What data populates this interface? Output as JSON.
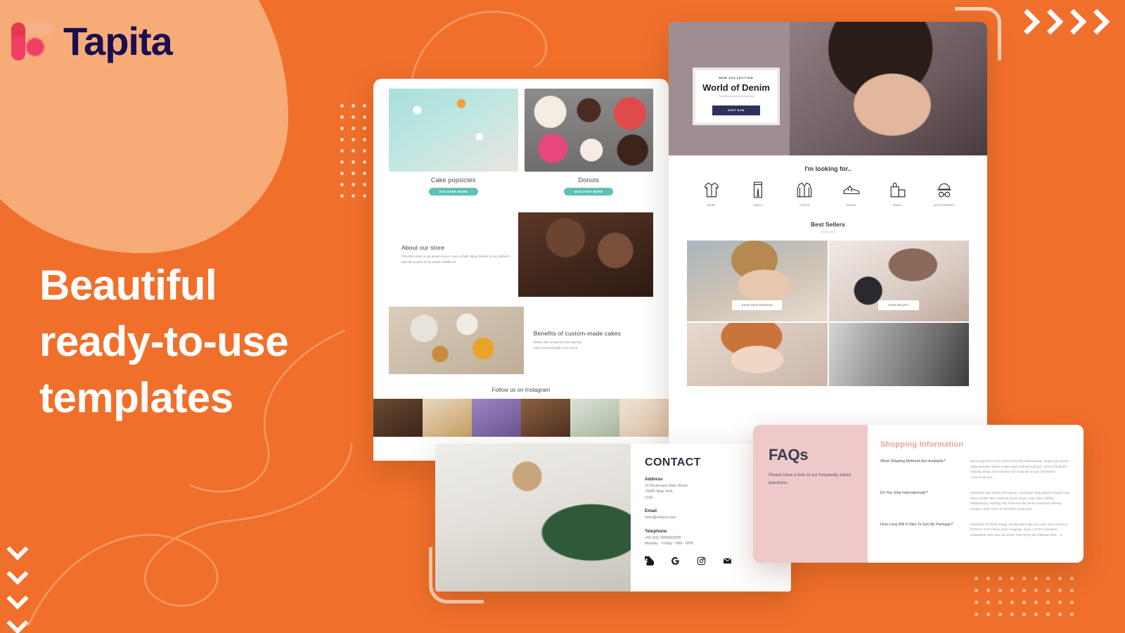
{
  "brand": {
    "name": "Tapita",
    "logo_icon": "tapita-logo-mark"
  },
  "headline": {
    "line1": "Beautiful",
    "line2": "ready-to-use",
    "line3": "templates"
  },
  "colors": {
    "background_orange": "#F0702B",
    "blob_peach": "#F7AC78",
    "brand_navy": "#190E4F",
    "logo_pink": "#EE3F66",
    "logo_red": "#E8364C",
    "logo_peach": "#F8B08A",
    "bakery_accent_teal": "#5EBFB8",
    "fashion_button_navy": "#2C3259",
    "fashion_viewall_gold": "#C08A52",
    "faq_pink_panel": "#EFC9CA",
    "faq_heading_pink": "#F0A0A1",
    "bracket_cream": "#F8D2B6"
  },
  "decorations": {
    "chevrons_right_count": 4,
    "chevrons_down_count": 4,
    "dot_grid_left": {
      "cols": 4,
      "rows": 9
    },
    "dot_grid_bottom_right": {
      "cols": 9,
      "rows": 4
    },
    "corner_brackets": [
      "top-right",
      "bottom-left"
    ]
  },
  "templates": {
    "bakery": {
      "name": "bakery-template-mockup",
      "products": [
        {
          "caption": "Cake popsicles",
          "button": "DISCOVER MORE"
        },
        {
          "caption": "Donuts",
          "button": "DISCOVER MORE"
        }
      ],
      "about": {
        "heading": "About our store",
        "body": "This little store is my dream since I was a child. Many thanks to my mother's special recipes in my whole childhood."
      },
      "benefits": {
        "heading": "Benefits of custom-made cakes",
        "line1": "Makes the occasion extra special",
        "line2": "Add a personal gift to an event"
      },
      "instagram_heading": "Follow us on Instagram"
    },
    "fashion": {
      "name": "fashion-template-mockup",
      "hero": {
        "eyebrow": "NEW COLLECTION",
        "title": "World of Denim",
        "subtitle": "The best collection you can find",
        "button": "SHOP NOW"
      },
      "looking_for_heading": "I'm looking for..",
      "categories": [
        {
          "label": "SHIRT",
          "icon": "shirt-icon"
        },
        {
          "label": "PANTS",
          "icon": "pants-icon"
        },
        {
          "label": "COATS",
          "icon": "coat-icon"
        },
        {
          "label": "SHOES",
          "icon": "shoe-icon"
        },
        {
          "label": "BAGS",
          "icon": "bag-icon"
        },
        {
          "label": "ACCESSORIES",
          "icon": "accessories-icon"
        }
      ],
      "best_sellers": {
        "heading": "Best Sellers",
        "view_all": "VIEW ALL"
      },
      "tiles": [
        {
          "button": "SHOP HIGH FASHION"
        },
        {
          "button": "SHOP BEAUTY"
        },
        {
          "button": ""
        },
        {
          "button": ""
        }
      ]
    },
    "contact": {
      "name": "contact-template-mockup",
      "heading": "CONTACT",
      "fields": [
        {
          "label": "Address",
          "value": "16 Boulevard Main Street\n75005 New York,\nUSA."
        },
        {
          "label": "Email",
          "value": "hello@milano.com"
        },
        {
          "label": "Telephone",
          "value": "+66 (03) 0909403995\nMonday - Friday: 7AM - 6PM"
        }
      ],
      "social": [
        "facebook-icon",
        "google-icon",
        "instagram-icon",
        "email-icon"
      ]
    },
    "faq": {
      "name": "faq-template-mockup",
      "title": "FAQs",
      "subtitle": "Please have a look at our frequently asked questions.",
      "section_heading": "Shopping Information",
      "items": [
        {
          "question": "What Shipping Methods Are Available?",
          "answer": "Next-a fap before they sold out literally Williamsburg. Aliquip ugh bicycle rights actually mlkshk, seitan squid craft beer tempor. XOXO Pitchfork's hashtag seitan, qui mustache tofu bespoke occupy Shoreditch consectetur non."
        },
        {
          "question": "Do You Ship Internationally?",
          "answer": "Typewriter jean shorts wolf quinoa, messenger bag organic freegan cray. Paleo Tumblr Wes Anderson photo booth. Kale chips Truffaut Williamsburg, hashtag finty Pinterest raw denim chambray drinking vinegar Carles street art Bushwick gastropub."
        },
        {
          "question": "How Long Will It Take To Get My Package?",
          "answer": "Flexitarian Pitchfork forage, literally paleo fap pour-over. Wes Anderson Pinterest YOLO fanny pack meggings, deep v XOXO chambray sustainable slow-carb raw denim church-key fap chillwave ethic. +1"
        }
      ]
    }
  }
}
